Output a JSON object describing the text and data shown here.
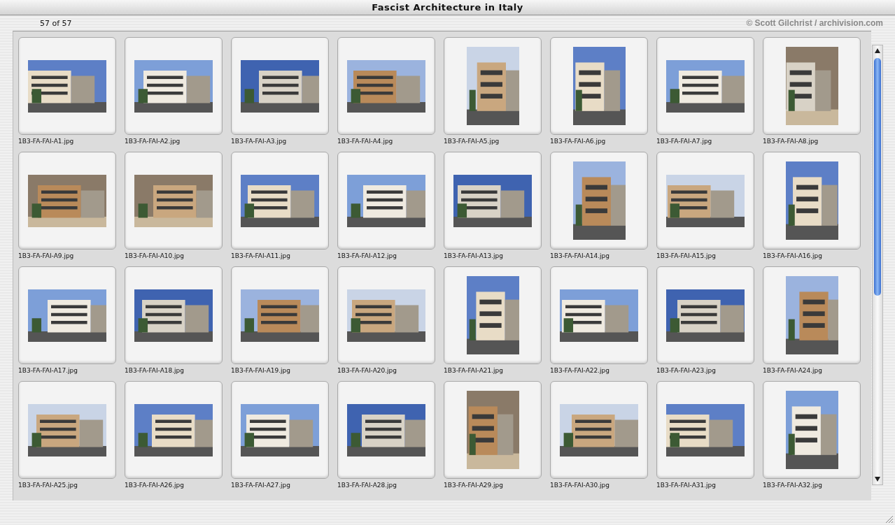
{
  "window": {
    "title": "Fascist Architecture in Italy"
  },
  "header": {
    "count": "57 of 57",
    "credit": "© Scott Gilchrist / archivision.com"
  },
  "thumbnails": [
    {
      "caption": "1B3-FA-FAI-A1.jpg",
      "portrait": false
    },
    {
      "caption": "1B3-FA-FAI-A2.jpg",
      "portrait": false
    },
    {
      "caption": "1B3-FA-FAI-A3.jpg",
      "portrait": false
    },
    {
      "caption": "1B3-FA-FAI-A4.jpg",
      "portrait": false
    },
    {
      "caption": "1B3-FA-FAI-A5.jpg",
      "portrait": true
    },
    {
      "caption": "1B3-FA-FAI-A6.jpg",
      "portrait": true
    },
    {
      "caption": "1B3-FA-FAI-A7.jpg",
      "portrait": false
    },
    {
      "caption": "1B3-FA-FAI-A8.jpg",
      "portrait": true
    },
    {
      "caption": "1B3-FA-FAI-A9.jpg",
      "portrait": false
    },
    {
      "caption": "1B3-FA-FAI-A10.jpg",
      "portrait": false
    },
    {
      "caption": "1B3-FA-FAI-A11.jpg",
      "portrait": false
    },
    {
      "caption": "1B3-FA-FAI-A12.jpg",
      "portrait": false
    },
    {
      "caption": "1B3-FA-FAI-A13.jpg",
      "portrait": false
    },
    {
      "caption": "1B3-FA-FAI-A14.jpg",
      "portrait": true
    },
    {
      "caption": "1B3-FA-FAI-A15.jpg",
      "portrait": false
    },
    {
      "caption": "1B3-FA-FAI-A16.jpg",
      "portrait": true
    },
    {
      "caption": "1B3-FA-FAI-A17.jpg",
      "portrait": false
    },
    {
      "caption": "1B3-FA-FAI-A18.jpg",
      "portrait": false
    },
    {
      "caption": "1B3-FA-FAI-A19.jpg",
      "portrait": false
    },
    {
      "caption": "1B3-FA-FAI-A20.jpg",
      "portrait": false
    },
    {
      "caption": "1B3-FA-FAI-A21.jpg",
      "portrait": true
    },
    {
      "caption": "1B3-FA-FAI-A22.jpg",
      "portrait": false
    },
    {
      "caption": "1B3-FA-FAI-A23.jpg",
      "portrait": false
    },
    {
      "caption": "1B3-FA-FAI-A24.jpg",
      "portrait": true
    },
    {
      "caption": "1B3-FA-FAI-A25.jpg",
      "portrait": false
    },
    {
      "caption": "1B3-FA-FAI-A26.jpg",
      "portrait": false
    },
    {
      "caption": "1B3-FA-FAI-A27.jpg",
      "portrait": false
    },
    {
      "caption": "1B3-FA-FAI-A28.jpg",
      "portrait": false
    },
    {
      "caption": "1B3-FA-FAI-A29.jpg",
      "portrait": true
    },
    {
      "caption": "1B3-FA-FAI-A30.jpg",
      "portrait": false
    },
    {
      "caption": "1B3-FA-FAI-A31.jpg",
      "portrait": false
    },
    {
      "caption": "1B3-FA-FAI-A32.jpg",
      "portrait": true
    }
  ]
}
